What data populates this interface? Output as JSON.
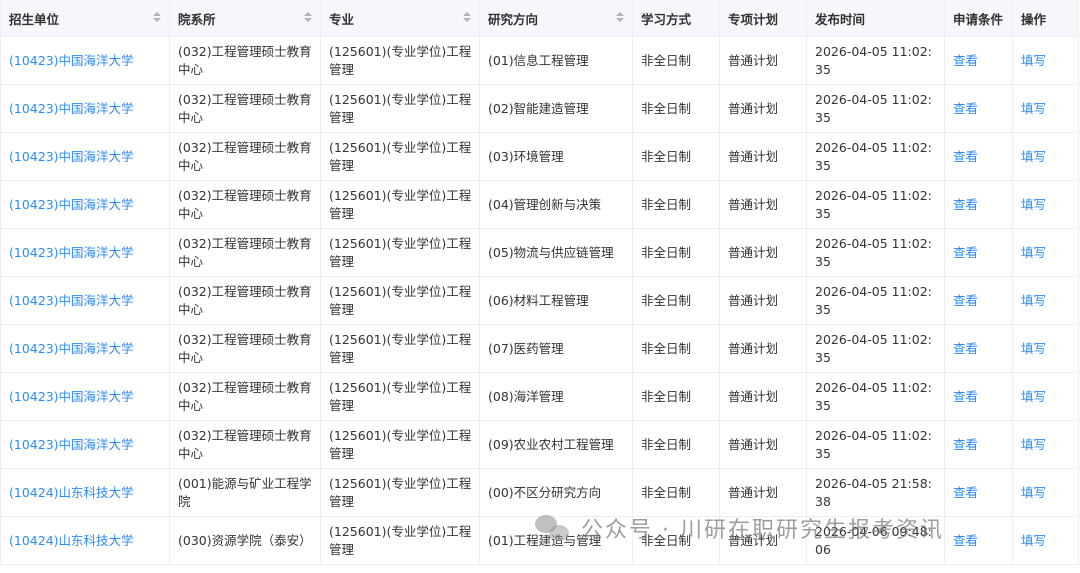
{
  "table": {
    "headers": [
      "招生单位",
      "院系所",
      "专业",
      "研究方向",
      "学习方式",
      "专项计划",
      "发布时间",
      "申请条件",
      "操作"
    ],
    "rows": [
      {
        "unit": "(10423)中国海洋大学",
        "dept": "(032)工程管理硕士教育中心",
        "major": "(125601)(专业学位)工程管理",
        "direction": "(01)信息工程管理",
        "mode": "非全日制",
        "plan": "普通计划",
        "time": "2026-04-05 11:02:35",
        "cond": "查看",
        "op": "填写"
      },
      {
        "unit": "(10423)中国海洋大学",
        "dept": "(032)工程管理硕士教育中心",
        "major": "(125601)(专业学位)工程管理",
        "direction": "(02)智能建造管理",
        "mode": "非全日制",
        "plan": "普通计划",
        "time": "2026-04-05 11:02:35",
        "cond": "查看",
        "op": "填写"
      },
      {
        "unit": "(10423)中国海洋大学",
        "dept": "(032)工程管理硕士教育中心",
        "major": "(125601)(专业学位)工程管理",
        "direction": "(03)环境管理",
        "mode": "非全日制",
        "plan": "普通计划",
        "time": "2026-04-05 11:02:35",
        "cond": "查看",
        "op": "填写"
      },
      {
        "unit": "(10423)中国海洋大学",
        "dept": "(032)工程管理硕士教育中心",
        "major": "(125601)(专业学位)工程管理",
        "direction": "(04)管理创新与决策",
        "mode": "非全日制",
        "plan": "普通计划",
        "time": "2026-04-05 11:02:35",
        "cond": "查看",
        "op": "填写"
      },
      {
        "unit": "(10423)中国海洋大学",
        "dept": "(032)工程管理硕士教育中心",
        "major": "(125601)(专业学位)工程管理",
        "direction": "(05)物流与供应链管理",
        "mode": "非全日制",
        "plan": "普通计划",
        "time": "2026-04-05 11:02:35",
        "cond": "查看",
        "op": "填写"
      },
      {
        "unit": "(10423)中国海洋大学",
        "dept": "(032)工程管理硕士教育中心",
        "major": "(125601)(专业学位)工程管理",
        "direction": "(06)材料工程管理",
        "mode": "非全日制",
        "plan": "普通计划",
        "time": "2026-04-05 11:02:35",
        "cond": "查看",
        "op": "填写"
      },
      {
        "unit": "(10423)中国海洋大学",
        "dept": "(032)工程管理硕士教育中心",
        "major": "(125601)(专业学位)工程管理",
        "direction": "(07)医药管理",
        "mode": "非全日制",
        "plan": "普通计划",
        "time": "2026-04-05 11:02:35",
        "cond": "查看",
        "op": "填写"
      },
      {
        "unit": "(10423)中国海洋大学",
        "dept": "(032)工程管理硕士教育中心",
        "major": "(125601)(专业学位)工程管理",
        "direction": "(08)海洋管理",
        "mode": "非全日制",
        "plan": "普通计划",
        "time": "2026-04-05 11:02:35",
        "cond": "查看",
        "op": "填写"
      },
      {
        "unit": "(10423)中国海洋大学",
        "dept": "(032)工程管理硕士教育中心",
        "major": "(125601)(专业学位)工程管理",
        "direction": "(09)农业农村工程管理",
        "mode": "非全日制",
        "plan": "普通计划",
        "time": "2026-04-05 11:02:35",
        "cond": "查看",
        "op": "填写"
      },
      {
        "unit": "(10424)山东科技大学",
        "dept": "(001)能源与矿业工程学院",
        "major": "(125601)(专业学位)工程管理",
        "direction": "(00)不区分研究方向",
        "mode": "非全日制",
        "plan": "普通计划",
        "time": "2026-04-05 21:58:38",
        "cond": "查看",
        "op": "填写"
      },
      {
        "unit": "(10424)山东科技大学",
        "dept": "(030)资源学院（泰安）",
        "major": "(125601)(专业学位)工程管理",
        "direction": "(01)工程建造与管理",
        "mode": "非全日制",
        "plan": "普通计划",
        "time": "2026-04-06 09:48:06",
        "cond": "查看",
        "op": "填写"
      }
    ]
  },
  "watermark": {
    "text": "公众号 · 川研在职研究生报考资讯"
  },
  "colors": {
    "link": "#2d8cf0",
    "header_bg": "#f5f7fa",
    "border": "#ebeef5"
  }
}
